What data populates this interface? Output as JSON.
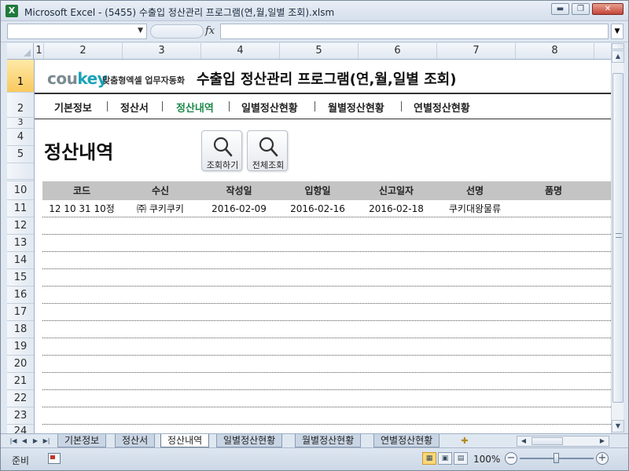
{
  "window": {
    "title": "Microsoft Excel - (5455) 수출입 정산관리 프로그램(연,월,일별 조회).xlsm",
    "app_icon": "X",
    "buttons": {
      "minimize": "▬",
      "restore": "❐",
      "close": "✕"
    }
  },
  "formula_bar": {
    "name_box": "",
    "fx": "fx",
    "formula": ""
  },
  "columns": [
    "1",
    "2",
    "3",
    "4",
    "5",
    "6",
    "7",
    "8"
  ],
  "rows": [
    "1",
    "2",
    "3",
    "4",
    "5",
    "10",
    "11",
    "12",
    "13",
    "14",
    "15",
    "16",
    "17",
    "18",
    "19",
    "20",
    "21",
    "22",
    "23",
    "24"
  ],
  "active_row": "1",
  "banner": {
    "logo_main": "cou",
    "logo_key": "key",
    "logo_tagline": "맞춤형엑셀 업무자동화",
    "title": "수출입 정산관리 프로그램(연,월,일별 조회)"
  },
  "nav": [
    {
      "label": "기본정보",
      "active": false
    },
    {
      "label": "정산서",
      "active": false
    },
    {
      "label": "정산내역",
      "active": true
    },
    {
      "label": "일별정산현황",
      "active": false
    },
    {
      "label": "월별정산현황",
      "active": false
    },
    {
      "label": "연별정산현황",
      "active": false
    }
  ],
  "section_title": "정산내역",
  "buttons": {
    "search": "조회하기",
    "search_all": "전체조회"
  },
  "table": {
    "headers": [
      "코드",
      "수신",
      "작성일",
      "입항일",
      "신고일자",
      "선명",
      "품명"
    ],
    "rows": [
      [
        "12 10 31 10정",
        "㈜ 쿠키쿠키",
        "2016-02-09",
        "2016-02-16",
        "2016-02-18",
        "쿠키대왕물류",
        ""
      ]
    ]
  },
  "sheet_tabs": [
    {
      "label": "기본정보",
      "active": false
    },
    {
      "label": "정산서",
      "active": false
    },
    {
      "label": "정산내역",
      "active": true
    },
    {
      "label": "일별정산현황",
      "active": false
    },
    {
      "label": "월별정산현황",
      "active": false
    },
    {
      "label": "연별정산현황",
      "active": false
    }
  ],
  "status": {
    "ready": "준비",
    "zoom": "100%"
  },
  "colors": {
    "accent_nav": "#1d8a4a",
    "logo_key": "#1aa3b8",
    "table_header_bg": "#c4c4c4"
  },
  "icons": [
    "excel-icon",
    "magnifier-icon",
    "macro-record-icon",
    "zoom-minus-icon",
    "zoom-plus-icon"
  ]
}
